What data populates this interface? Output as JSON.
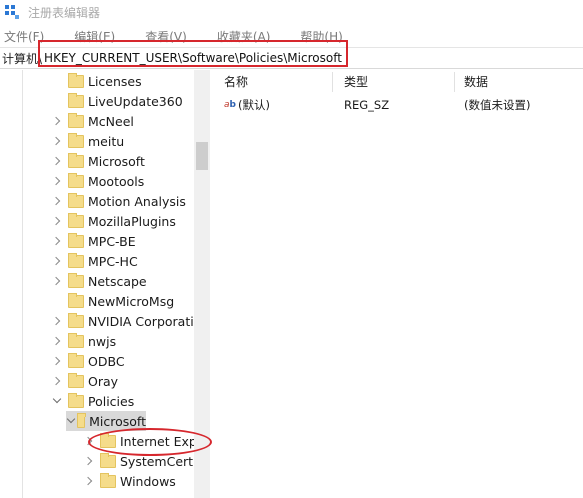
{
  "window": {
    "title": "注册表编辑器"
  },
  "menu": [
    "文件(F)",
    "编辑(E)",
    "查看(V)",
    "收藏夹(A)",
    "帮助(H)"
  ],
  "address": {
    "label": "计算机\\",
    "path": "HKEY_CURRENT_USER\\Software\\Policies\\Microsoft"
  },
  "tree": [
    {
      "label": "Licenses",
      "expander": "none"
    },
    {
      "label": "LiveUpdate360",
      "expander": "none"
    },
    {
      "label": "McNeel",
      "expander": "right"
    },
    {
      "label": "meitu",
      "expander": "right"
    },
    {
      "label": "Microsoft",
      "expander": "right"
    },
    {
      "label": "Mootools",
      "expander": "right"
    },
    {
      "label": "Motion Analysis",
      "expander": "right"
    },
    {
      "label": "MozillaPlugins",
      "expander": "right"
    },
    {
      "label": "MPC-BE",
      "expander": "right"
    },
    {
      "label": "MPC-HC",
      "expander": "right"
    },
    {
      "label": "Netscape",
      "expander": "right"
    },
    {
      "label": "NewMicroMsg",
      "expander": "none"
    },
    {
      "label": "NVIDIA Corporatio",
      "expander": "right"
    },
    {
      "label": "nwjs",
      "expander": "right"
    },
    {
      "label": "ODBC",
      "expander": "right"
    },
    {
      "label": "Oray",
      "expander": "right"
    },
    {
      "label": "Policies",
      "expander": "down"
    },
    {
      "label": "Microsoft",
      "expander": "down",
      "selected": true
    },
    {
      "label": "Internet Expl",
      "expander": "right"
    },
    {
      "label": "SystemCertifi",
      "expander": "right"
    },
    {
      "label": "Windows",
      "expander": "right"
    }
  ],
  "columns": {
    "name": "名称",
    "type": "类型",
    "data": "数据"
  },
  "values": [
    {
      "name": "(默认)",
      "type": "REG_SZ",
      "data": "(数值未设置)"
    }
  ],
  "colors": {
    "annotation": "#d6272d",
    "folder": "#f5dc8a",
    "selection": "#d9d9d9"
  }
}
